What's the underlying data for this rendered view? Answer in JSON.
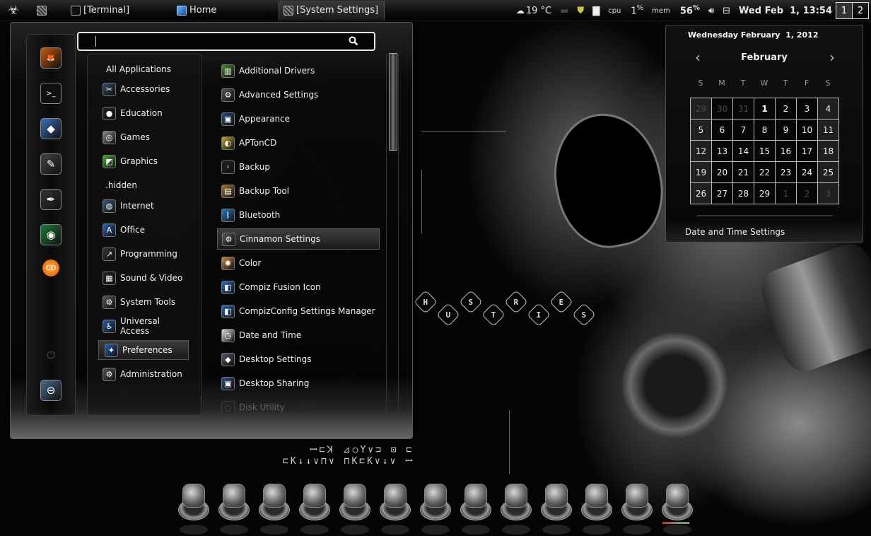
{
  "top_panel": {
    "menu_icon": "biohazard-icon",
    "show_desktop_icon": "desktop-settings-icon",
    "tasks": [
      {
        "label": "[Terminal]",
        "icon": "terminal-icon",
        "active": false
      },
      {
        "label": "Home",
        "icon": "home-folder-icon",
        "active": false
      },
      {
        "label": "[System Settings]",
        "icon": "system-settings-icon",
        "active": true
      }
    ],
    "tray": {
      "weather": "19 °C",
      "cpu_label": "cpu",
      "cpu_value": "1",
      "cpu_unit": "%",
      "mem_label": "mem",
      "mem_value": "56",
      "mem_unit": "%",
      "clock": "Wed Feb  1, 13:54"
    },
    "workspaces": [
      "1",
      "2"
    ],
    "active_workspace": "1"
  },
  "menu": {
    "search": {
      "value": "",
      "placeholder": ""
    },
    "favorites": [
      {
        "name": "firefox",
        "glyph": "🦊"
      },
      {
        "name": "terminal",
        "glyph": ">_"
      },
      {
        "name": "desktop-settings",
        "glyph": "◆"
      },
      {
        "name": "gimp",
        "glyph": "✎"
      },
      {
        "name": "inkscape",
        "glyph": "✒"
      },
      {
        "name": "chrome",
        "glyph": "◉"
      },
      {
        "name": "cd-burner",
        "glyph": "CD"
      },
      {
        "name": "shutdown",
        "glyph": "⏻"
      },
      {
        "name": "logout",
        "glyph": "⊖"
      }
    ],
    "all_applications": "All Applications",
    "categories": [
      {
        "label": "Accessories",
        "icon": "✂",
        "color": "#2a4a6a"
      },
      {
        "label": "Education",
        "icon": "●",
        "color": "#222"
      },
      {
        "label": "Games",
        "icon": "◎",
        "color": "#888"
      },
      {
        "label": "Graphics",
        "icon": "◩",
        "color": "#4a3"
      },
      {
        "label": ".hidden",
        "icon": "",
        "color": ""
      },
      {
        "label": "Internet",
        "icon": "◍",
        "color": "#3a5a7a"
      },
      {
        "label": "Office",
        "icon": "A",
        "color": "#2b5fb4"
      },
      {
        "label": "Programming",
        "icon": "↗",
        "color": "#333"
      },
      {
        "label": "Sound & Video",
        "icon": "▦",
        "color": "#222"
      },
      {
        "label": "System Tools",
        "icon": "⚙",
        "color": "#555"
      },
      {
        "label": "Universal Access",
        "icon": "♿",
        "color": "#2a5ca8"
      },
      {
        "label": "Preferences",
        "icon": "✦",
        "color": "#2a5ca8",
        "selected": true
      },
      {
        "label": "Administration",
        "icon": "⚙",
        "color": "#555"
      }
    ],
    "applications": [
      {
        "label": "Additional Drivers",
        "icon": "▥",
        "color": "#4a8a2a"
      },
      {
        "label": "Advanced Settings",
        "icon": "⚙",
        "color": "#555"
      },
      {
        "label": "Appearance",
        "icon": "▣",
        "color": "#2a4a7a"
      },
      {
        "label": "APTonCD",
        "icon": "◐",
        "color": "#c9a030"
      },
      {
        "label": "Backup",
        "icon": "◦",
        "color": "#222"
      },
      {
        "label": "Backup Tool",
        "icon": "▤",
        "color": "#a07a30"
      },
      {
        "label": "Bluetooth",
        "icon": "ᛒ",
        "color": "#2a7ac8"
      },
      {
        "label": "Cinnamon Settings",
        "icon": "⚙",
        "color": "#555",
        "selected": true
      },
      {
        "label": "Color",
        "icon": "✺",
        "color": "#c84"
      },
      {
        "label": "Compiz Fusion Icon",
        "icon": "◧",
        "color": "#2a6ab8"
      },
      {
        "label": "CompizConfig Settings Manager",
        "icon": "◧",
        "color": "#2a6ab8"
      },
      {
        "label": "Date and Time",
        "icon": "◷",
        "color": "#ddd"
      },
      {
        "label": "Desktop Settings",
        "icon": "◆",
        "color": "#556"
      },
      {
        "label": "Desktop Sharing",
        "icon": "▣",
        "color": "#2a4a7a"
      },
      {
        "label": "Disk Utility",
        "icon": "◌",
        "color": "#333",
        "faded": true
      }
    ]
  },
  "calendar": {
    "full_date": "Wednesday February  1, 2012",
    "month": "February",
    "weekdays": [
      "S",
      "M",
      "T",
      "W",
      "T",
      "F",
      "S"
    ],
    "weeks": [
      [
        "29",
        "30",
        "31",
        "1",
        "2",
        "3",
        "4"
      ],
      [
        "5",
        "6",
        "7",
        "8",
        "9",
        "10",
        "11"
      ],
      [
        "12",
        "13",
        "14",
        "15",
        "16",
        "17",
        "18"
      ],
      [
        "19",
        "20",
        "21",
        "22",
        "23",
        "24",
        "25"
      ],
      [
        "26",
        "27",
        "28",
        "29",
        "1",
        "2",
        "3"
      ]
    ],
    "other_month_cells": [
      [
        0,
        0
      ],
      [
        0,
        1
      ],
      [
        0,
        2
      ],
      [
        4,
        4
      ],
      [
        4,
        5
      ],
      [
        4,
        6
      ]
    ],
    "today_cell": [
      0,
      3
    ],
    "settings_link": "Date and Time Settings"
  },
  "dock": {
    "items": [
      "terminal",
      "printer",
      "system-monitor",
      "pidgin",
      "inkscape",
      "banshee",
      "gimp",
      "opera",
      "chrome",
      "settings",
      "file-manager",
      "display",
      "audio"
    ]
  },
  "wallpaper": {
    "hex_letters": [
      "H",
      "U",
      "S",
      "T",
      "R",
      "I",
      "E",
      "S"
    ]
  }
}
